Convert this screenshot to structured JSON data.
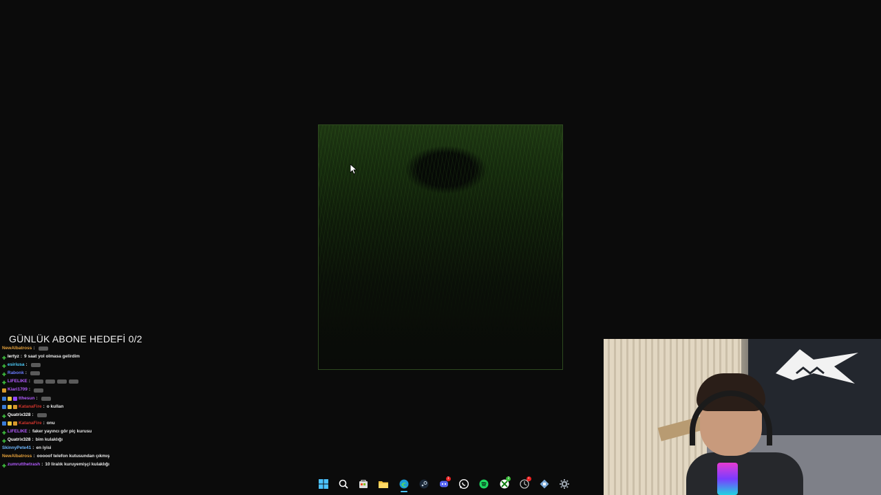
{
  "overlay": {
    "goal_text": "GÜNLÜK ABONE HEDEFİ 0/2"
  },
  "chat": [
    {
      "badges": [],
      "user": "NewAlbatross",
      "color": "#e6a23c",
      "sep": ":",
      "text": "",
      "emotes": 1
    },
    {
      "badges": [
        "plus"
      ],
      "user": "lertyz",
      "color": "#ffffff",
      "sep": ":",
      "text": "9 saat yol olmasa gelirdim",
      "emotes": 0
    },
    {
      "badges": [
        "plus"
      ],
      "user": "esiriusa",
      "color": "#4fd0ff",
      "sep": ":",
      "text": "",
      "emotes": 1
    },
    {
      "badges": [
        "plus"
      ],
      "user": "Rabonk",
      "color": "#6a7cff",
      "sep": ":",
      "text": "",
      "emotes": 1
    },
    {
      "badges": [
        "plus"
      ],
      "user": "LIFELIKE",
      "color": "#b45cff",
      "sep": ":",
      "text": "",
      "emotes": 4
    },
    {
      "badges": [
        "gold"
      ],
      "user": "Kiari1709",
      "color": "#b45cff",
      "sep": ":",
      "text": "",
      "emotes": 1
    },
    {
      "badges": [
        "blue",
        "yellow",
        "purple"
      ],
      "user": "tthesun",
      "color": "#b45cff",
      "sep": ":",
      "text": "",
      "emotes": 1
    },
    {
      "badges": [
        "blue",
        "yellow",
        "gold"
      ],
      "user": "KatanaFire",
      "color": "#d0342c",
      "sep": ":",
      "text": "o kullan",
      "emotes": 0
    },
    {
      "badges": [
        "plus"
      ],
      "user": "Quatrix328",
      "color": "#ffffff",
      "sep": ":",
      "text": "",
      "emotes": 1
    },
    {
      "badges": [
        "blue",
        "yellow",
        "gold"
      ],
      "user": "KatanaFire",
      "color": "#d0342c",
      "sep": ":",
      "text": "onu",
      "emotes": 0
    },
    {
      "badges": [
        "plus"
      ],
      "user": "LIFELIKE",
      "color": "#b45cff",
      "sep": ":",
      "text": "faker yayıncı gör piç kurusu",
      "emotes": 0
    },
    {
      "badges": [
        "plus"
      ],
      "user": "Quatrix328",
      "color": "#ffffff",
      "sep": ":",
      "text": "bim kulaklığı",
      "emotes": 0
    },
    {
      "badges": [],
      "user": "SkinnyPete41",
      "color": "#6fb8ff",
      "sep": ":",
      "text": "en iyisi",
      "emotes": 0
    },
    {
      "badges": [],
      "user": "NewAlbatross",
      "color": "#e6a23c",
      "sep": ":",
      "text": "ooooof telefon kutusundan çıkmış",
      "emotes": 0
    },
    {
      "badges": [
        "plus"
      ],
      "user": "zumrutthetrash",
      "color": "#b45cff",
      "sep": ":",
      "text": "10 liralık kuruyemişçi kulaklığı",
      "emotes": 0
    }
  ],
  "taskbar": {
    "items": [
      {
        "icon": "windows-start-icon",
        "badge": ""
      },
      {
        "icon": "search-icon",
        "badge": ""
      },
      {
        "icon": "store-icon",
        "badge": ""
      },
      {
        "icon": "file-explorer-icon",
        "badge": ""
      },
      {
        "icon": "edge-browser-icon",
        "badge": "",
        "active": true
      },
      {
        "icon": "steam-icon",
        "badge": ""
      },
      {
        "icon": "discord-icon",
        "badge": "1"
      },
      {
        "icon": "whatsapp-icon",
        "badge": ""
      },
      {
        "icon": "spotify-icon",
        "badge": ""
      },
      {
        "icon": "xbox-icon",
        "badge": "2"
      },
      {
        "icon": "game-controller-icon",
        "badge": "•"
      },
      {
        "icon": "app-icon",
        "badge": ""
      },
      {
        "icon": "settings-gear-icon",
        "badge": ""
      }
    ]
  },
  "colors": {
    "background": "#0b0b0b",
    "view_green": "#2e4a1f",
    "taskbar_active": "#4cc2ff"
  }
}
